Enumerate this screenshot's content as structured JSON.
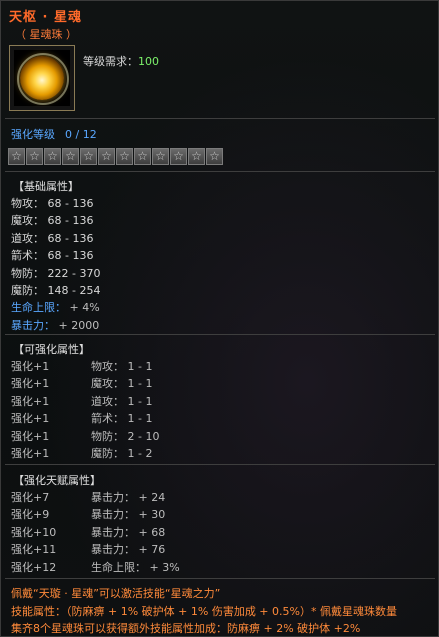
{
  "title": "天枢 · 星魂",
  "subtitle": "（ 星魂珠 ）",
  "level_req_label": "等级需求：",
  "level_req_value": "100",
  "enhance_label": "强化等级",
  "enhance_value": "0 / 12",
  "star_count": 12,
  "star_icon": "☆",
  "base_title": "【基础属性】",
  "base_attrs": [
    {
      "label": "物攻：",
      "value": "68 - 136"
    },
    {
      "label": "魔攻：",
      "value": "68 - 136"
    },
    {
      "label": "道攻：",
      "value": "68 - 136"
    },
    {
      "label": "箭术：",
      "value": "68 - 136"
    },
    {
      "label": "物防：",
      "value": "222 - 370"
    },
    {
      "label": "魔防：",
      "value": "148 - 254"
    },
    {
      "label": "生命上限：",
      "value": "+ 4%"
    },
    {
      "label": "暴击力：",
      "value": "+ 2000"
    }
  ],
  "enhanceable_title": "【可强化属性】",
  "enhanceable_attrs": [
    {
      "level": "强化+1",
      "attr": "物攻：",
      "value": "1 - 1"
    },
    {
      "level": "强化+1",
      "attr": "魔攻：",
      "value": "1 - 1"
    },
    {
      "level": "强化+1",
      "attr": "道攻：",
      "value": "1 - 1"
    },
    {
      "level": "强化+1",
      "attr": "箭术：",
      "value": "1 - 1"
    },
    {
      "level": "强化+1",
      "attr": "物防：",
      "value": "2 - 10"
    },
    {
      "level": "强化+1",
      "attr": "魔防：",
      "value": "1 - 2"
    }
  ],
  "talent_title": "【强化天赋属性】",
  "talent_attrs": [
    {
      "level": "强化+7",
      "attr": "暴击力：",
      "value": "+ 24"
    },
    {
      "level": "强化+9",
      "attr": "暴击力：",
      "value": "+ 30"
    },
    {
      "level": "强化+10",
      "attr": "暴击力：",
      "value": "+ 68"
    },
    {
      "level": "强化+11",
      "attr": "暴击力：",
      "value": "+ 76"
    },
    {
      "level": "强化+12",
      "attr": "生命上限：",
      "value": "+ 3%"
    }
  ],
  "footer": [
    "佩戴“天璇 · 星魂”可以激活技能“星魂之力”",
    "技能属性：（防麻痹 + 1%  破护体 + 1%  伤害加成 + 0.5%）* 佩戴星魂珠数量",
    "集齐8个星魂珠可以获得额外技能属性加成：防麻痹 + 2%  破护体 +2%"
  ],
  "colors": {
    "title": "#ff6a2a",
    "accent_blue": "#5aa8ff",
    "level_green": "#7cf06a",
    "footer_orange": "#ff8a3a"
  }
}
